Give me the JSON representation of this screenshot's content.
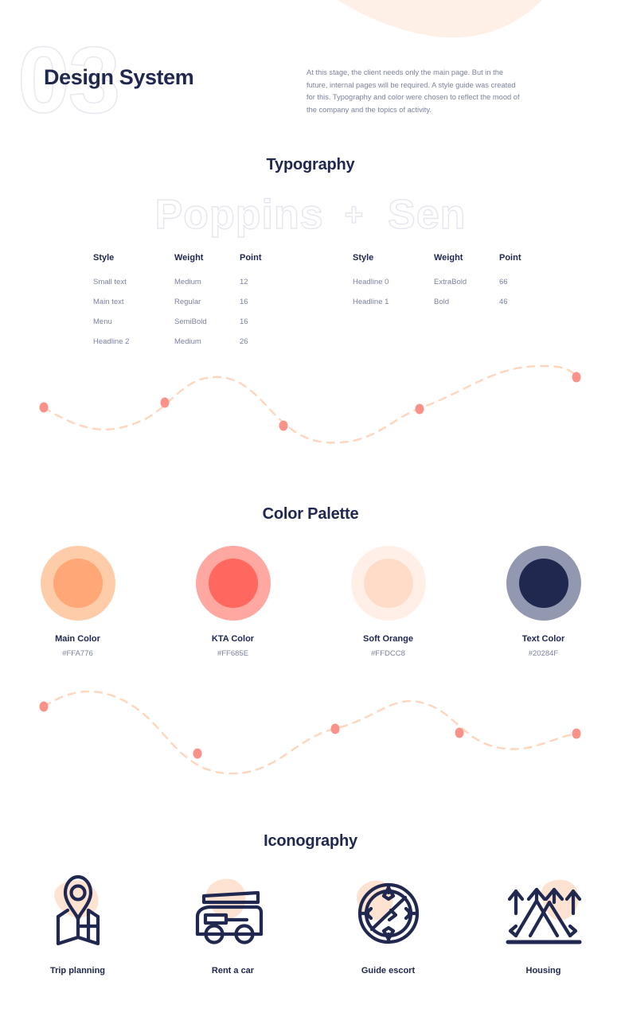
{
  "header": {
    "number": "03",
    "title": "Design System",
    "intro": "At this stage, the client needs only the main page. But in the future, internal pages will be required. A style guide was created for this.  Typography and color were chosen to reflect the mood of the company and the topics of activity."
  },
  "typography": {
    "heading": "Typography",
    "fonts": {
      "primary": "Poppins",
      "separator": "+",
      "secondary": "Sen"
    },
    "columns": [
      "Style",
      "Weight",
      "Point"
    ],
    "left_rows": [
      {
        "style": "Small text",
        "weight": "Medium",
        "point": "12"
      },
      {
        "style": "Main text",
        "weight": "Regular",
        "point": "16"
      },
      {
        "style": "Menu",
        "weight": "SemiBold",
        "point": "16"
      },
      {
        "style": "Headline 2",
        "weight": "Medium",
        "point": "26"
      }
    ],
    "right_rows": [
      {
        "style": "Headline 0",
        "weight": "ExtraBold",
        "point": "66"
      },
      {
        "style": "Headline 1",
        "weight": "Bold",
        "point": "46"
      }
    ]
  },
  "palette": {
    "heading": "Color Palette",
    "swatches": [
      {
        "name": "Main Color",
        "hex": "#FFA776",
        "ring": "#FFCCAA"
      },
      {
        "name": "KTA Color",
        "hex": "#FF685E",
        "ring": "#FFA7A1"
      },
      {
        "name": "Soft Orange",
        "hex": "#FFDCC8",
        "ring": "#FFEFE6"
      },
      {
        "name": "Text Color",
        "hex": "#20284F",
        "ring": "#9298B0"
      }
    ]
  },
  "iconography": {
    "heading": "Iconography",
    "items": [
      {
        "label": "Trip planning",
        "icon": "map-pin-icon"
      },
      {
        "label": "Rent a car",
        "icon": "camper-van-icon"
      },
      {
        "label": "Guide escort",
        "icon": "compass-icon"
      },
      {
        "label": "Housing",
        "icon": "tent-icon"
      }
    ]
  },
  "decor": {
    "blob_color": "#FFF0E7",
    "wave_stroke": "#FFD5BC",
    "wave_dot": "#FA9289",
    "icon_blob": "#FFE3D2",
    "icon_stroke": "#20284F"
  }
}
